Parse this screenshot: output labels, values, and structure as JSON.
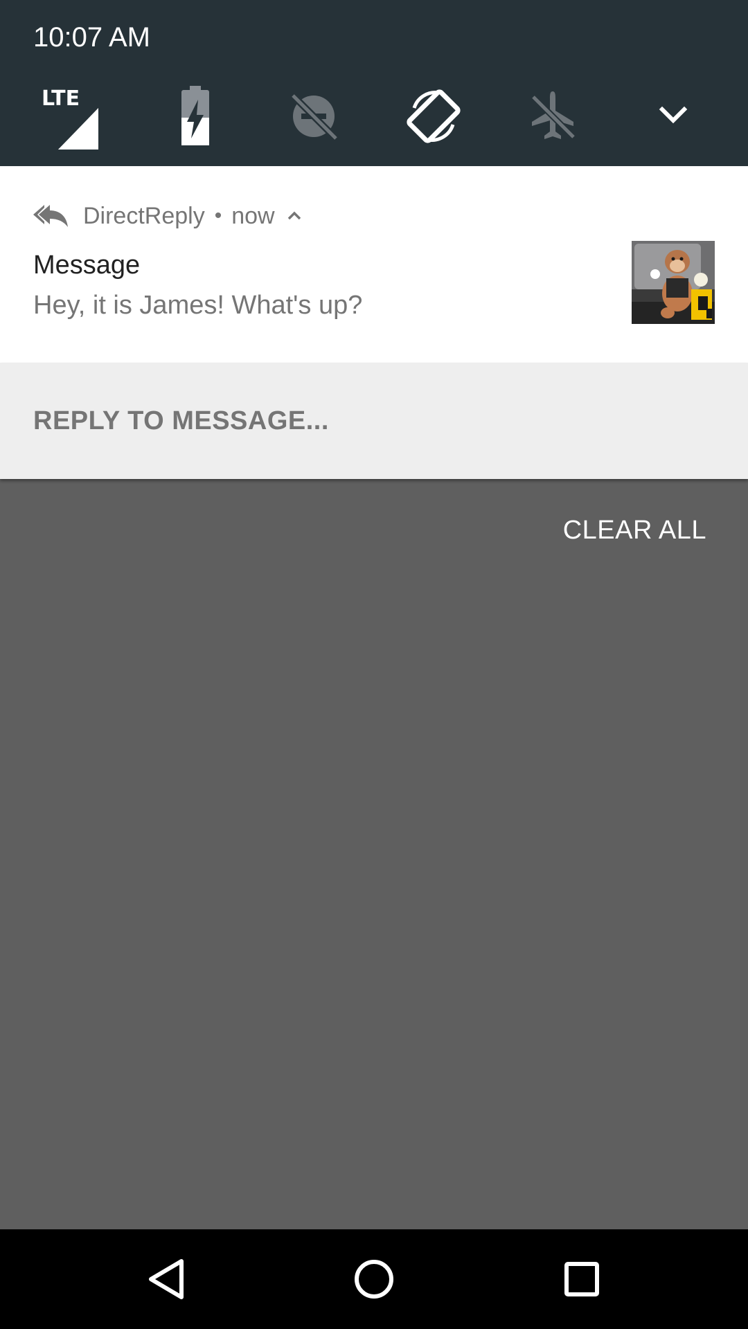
{
  "status": {
    "time": "10:07 AM"
  },
  "quick_settings": {
    "tiles": [
      {
        "icon": "lte-signal-icon",
        "label": "LTE",
        "active": true
      },
      {
        "icon": "battery-charging-icon",
        "active": true
      },
      {
        "icon": "do-not-disturb-off-icon",
        "active": false
      },
      {
        "icon": "auto-rotate-icon",
        "active": true
      },
      {
        "icon": "airplane-mode-off-icon",
        "active": false
      },
      {
        "icon": "expand-chevron-icon"
      }
    ]
  },
  "notification": {
    "app_icon": "reply-arrow-icon",
    "app_name": "DirectReply",
    "separator": "•",
    "time": "now",
    "title": "Message",
    "text": "Hey, it is James! What's up?",
    "thumbnail": "monkey-photo-thumbnail",
    "reply_action": "REPLY TO MESSAGE..."
  },
  "shade": {
    "clear_all": "CLEAR ALL"
  },
  "navigation": {
    "buttons": [
      "back-icon",
      "home-icon",
      "recents-icon"
    ]
  },
  "colors": {
    "header_bg": "#263238",
    "shade_bg": "#5f5f5f",
    "card_bg": "#ffffff",
    "action_bg": "#eeeeee",
    "secondary_text": "#757575"
  }
}
